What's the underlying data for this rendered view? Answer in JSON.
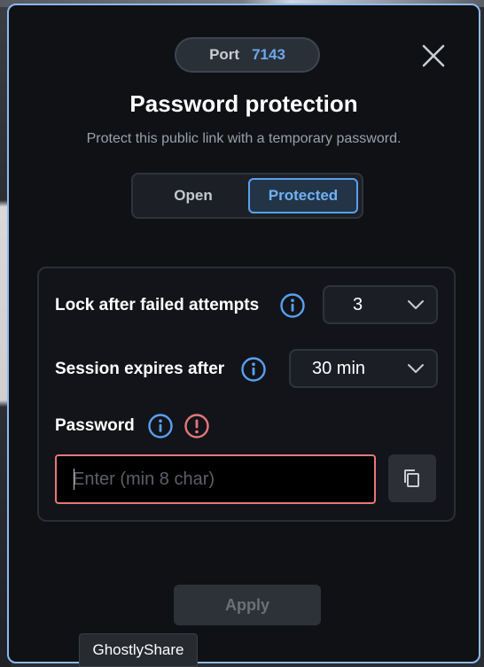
{
  "header": {
    "port_label": "Port",
    "port_value": "7143",
    "close_icon": "close-icon"
  },
  "dialog": {
    "title": "Password protection",
    "subtitle": "Protect this public link with a temporary password."
  },
  "mode_toggle": {
    "options": [
      "Open",
      "Protected"
    ],
    "selected": "Protected"
  },
  "settings": {
    "lock_label": "Lock after failed attempts",
    "lock_value": "3",
    "session_label": "Session expires after",
    "session_value": "30 min",
    "password_label": "Password",
    "password_placeholder": "Enter (min 8 char)",
    "password_value": ""
  },
  "actions": {
    "apply_label": "Apply"
  },
  "taskbar_tooltip": {
    "label": "GhostlyShare"
  },
  "colors": {
    "accent": "#5aa0f0",
    "error": "#e5787a",
    "background": "#0f1115"
  }
}
